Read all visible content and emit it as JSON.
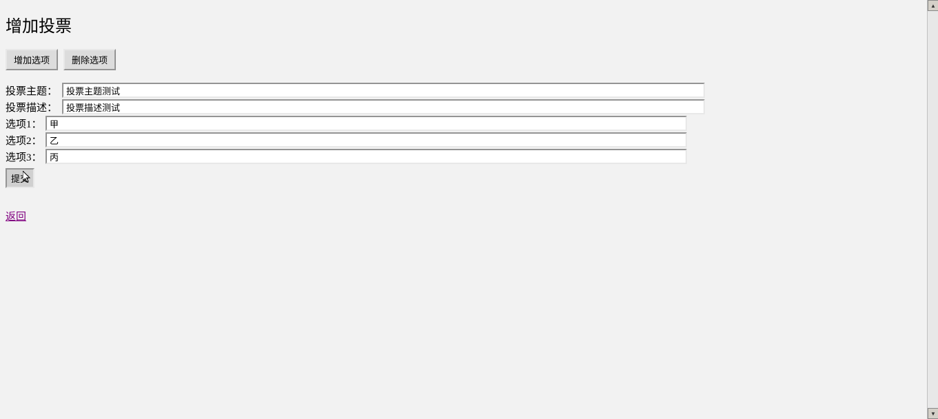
{
  "page": {
    "title": "增加投票"
  },
  "buttons": {
    "add_option": "增加选项",
    "delete_option": "删除选项",
    "submit": "提交"
  },
  "form": {
    "subject_label": "投票主题：",
    "subject_value": "投票主题测试",
    "description_label": "投票描述：",
    "description_value": "投票描述测试"
  },
  "options": [
    {
      "label": "选项1：",
      "value": "甲"
    },
    {
      "label": "选项2：",
      "value": "乙"
    },
    {
      "label": "选项3：",
      "value": "丙"
    }
  ],
  "link": {
    "back": "返回"
  }
}
